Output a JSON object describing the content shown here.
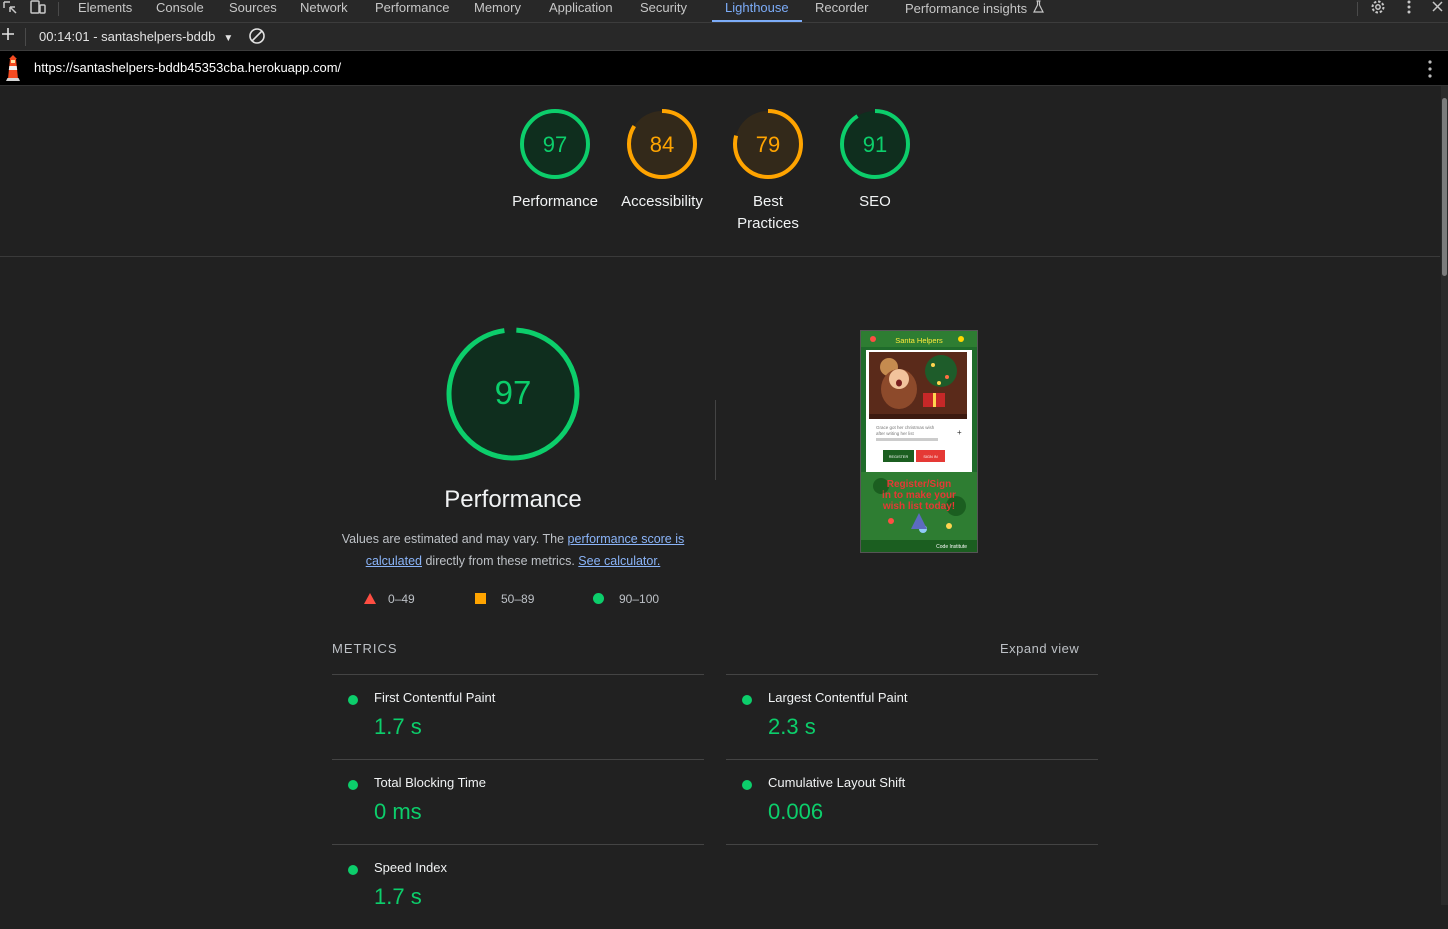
{
  "devtools_tabs": [
    "Elements",
    "Console",
    "Sources",
    "Network",
    "Performance",
    "Memory",
    "Application",
    "Security",
    "Lighthouse",
    "Recorder",
    "Performance insights"
  ],
  "active_tab": "Lighthouse",
  "toolbar": {
    "report_select": "00:14:01 - santashelpers-bddb"
  },
  "report": {
    "url": "https://santashelpers-bddb45353cba.herokuapp.com/"
  },
  "scores": [
    {
      "label": "Performance",
      "value": "97",
      "color": "#0cce6b"
    },
    {
      "label": "Accessibility",
      "value": "84",
      "color": "#ffa400"
    },
    {
      "label": "Best Practices",
      "value": "79",
      "color": "#ffa400"
    },
    {
      "label": "SEO",
      "value": "91",
      "color": "#0cce6b"
    }
  ],
  "performance": {
    "score": "97",
    "title": "Performance",
    "desc_text": "Values are estimated and may vary. The",
    "link_score": "performance score is calculated",
    "desc_mid": "directly from these metrics.",
    "link_calc": "See calculator.",
    "legend": {
      "fail": "0–49",
      "average": "50–89",
      "pass": "90–100"
    }
  },
  "screenshot": {
    "site_title": "Santa Helpers",
    "caption": "Grace got her christmas wish after writing her list",
    "btn_register": "REGISTER",
    "btn_signin": "SIGN IN",
    "cta": "Register/Sign in to make your wish list today!",
    "footer": "Code Institute"
  },
  "metrics": {
    "heading": "METRICS",
    "expand": "Expand view",
    "items": [
      {
        "title": "First Contentful Paint",
        "value": "1.7 s"
      },
      {
        "title": "Largest Contentful Paint",
        "value": "2.3 s"
      },
      {
        "title": "Total Blocking Time",
        "value": "0 ms"
      },
      {
        "title": "Cumulative Layout Shift",
        "value": "0.006"
      },
      {
        "title": "Speed Index",
        "value": "1.7 s"
      }
    ]
  },
  "colors": {
    "pass": "#0cce6b",
    "average": "#ffa400",
    "fail": "#ff4e42",
    "link": "#8ab4f8"
  }
}
